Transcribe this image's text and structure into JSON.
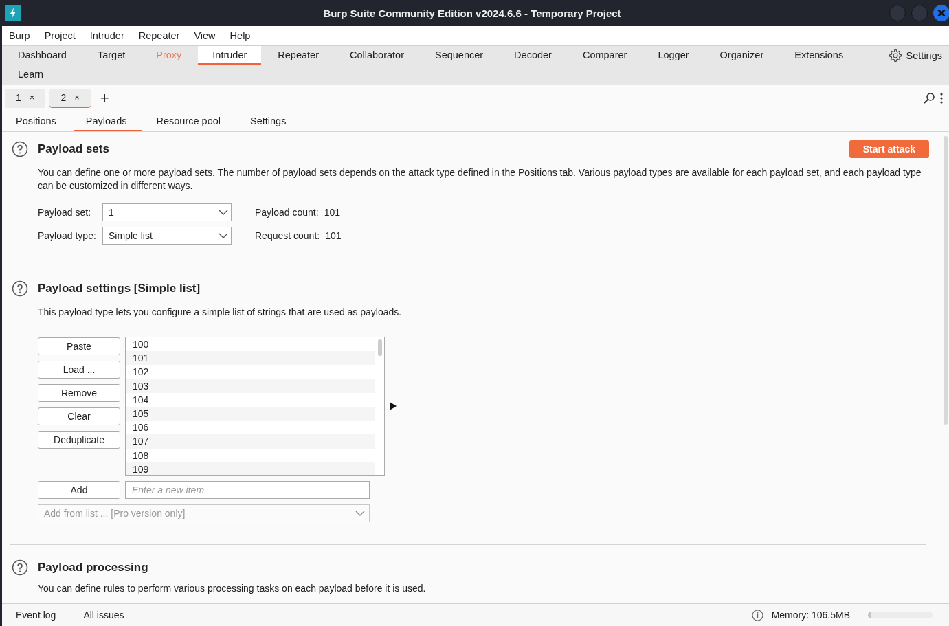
{
  "window": {
    "title": "Burp Suite Community Edition v2024.6.6 - Temporary Project"
  },
  "menu": [
    "Burp",
    "Project",
    "Intruder",
    "Repeater",
    "View",
    "Help"
  ],
  "tool_tab_rows": [
    [
      {
        "label": "Dashboard",
        "selected": false,
        "highlighted": false
      },
      {
        "label": "Target",
        "selected": false,
        "highlighted": false
      },
      {
        "label": "Proxy",
        "selected": false,
        "highlighted": true
      },
      {
        "label": "Intruder",
        "selected": true,
        "highlighted": false
      },
      {
        "label": "Repeater",
        "selected": false,
        "highlighted": false
      },
      {
        "label": "Collaborator",
        "selected": false,
        "highlighted": false
      },
      {
        "label": "Sequencer",
        "selected": false,
        "highlighted": false
      },
      {
        "label": "Decoder",
        "selected": false,
        "highlighted": false
      },
      {
        "label": "Comparer",
        "selected": false,
        "highlighted": false
      },
      {
        "label": "Logger",
        "selected": false,
        "highlighted": false
      },
      {
        "label": "Organizer",
        "selected": false,
        "highlighted": false
      },
      {
        "label": "Extensions",
        "selected": false,
        "highlighted": false
      }
    ],
    [
      {
        "label": "Learn",
        "selected": false,
        "highlighted": false
      }
    ]
  ],
  "settings_button": "Settings",
  "attack_tabs": [
    {
      "label": "1",
      "close": "×",
      "selected": false
    },
    {
      "label": "2",
      "close": "×",
      "selected": true
    }
  ],
  "new_tab_button": "+",
  "section_tabs": [
    {
      "label": "Positions",
      "selected": false
    },
    {
      "label": "Payloads",
      "selected": true
    },
    {
      "label": "Resource pool",
      "selected": false
    },
    {
      "label": "Settings",
      "selected": false
    }
  ],
  "payload_sets": {
    "title": "Payload sets",
    "start_button": "Start attack",
    "description": "You can define one or more payload sets. The number of payload sets depends on the attack type defined in the Positions tab. Various payload types are available for each payload set, and each payload type can be customized in different ways.",
    "fields": [
      {
        "label": "Payload set:",
        "value": "1",
        "info_label": "Payload count:",
        "info_value": "101"
      },
      {
        "label": "Payload type:",
        "value": "Simple list",
        "info_label": "Request count:",
        "info_value": "101"
      }
    ]
  },
  "payload_settings": {
    "title": "Payload settings [Simple list]",
    "description": "This payload type lets you configure a simple list of strings that are used as payloads.",
    "buttons": [
      "Paste",
      "Load ...",
      "Remove",
      "Clear",
      "Deduplicate"
    ],
    "items": [
      "100",
      "101",
      "102",
      "103",
      "104",
      "105",
      "106",
      "107",
      "108",
      "109"
    ],
    "add_button": "Add",
    "new_item": {
      "placeholder": "Enter a new item"
    },
    "add_from_list": {
      "placeholder": "Add from list ... [Pro version only]",
      "disabled": true
    }
  },
  "payload_processing": {
    "title": "Payload processing",
    "description": "You can define rules to perform various processing tasks on each payload before it is used."
  },
  "status_bar": {
    "tabs": [
      "Event log",
      "All issues"
    ],
    "memory": "Memory: 106.5MB",
    "memory_level": {
      "level": 0.05
    }
  }
}
